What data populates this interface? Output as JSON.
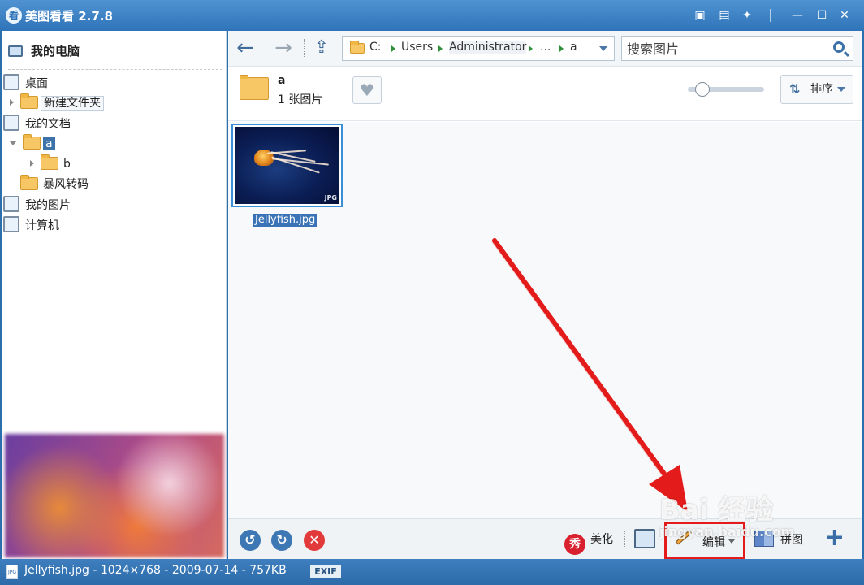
{
  "window": {
    "icon_char": "看",
    "title": "美图看看 2.7.8",
    "buttons": [
      "feedback",
      "menu",
      "skin",
      "minimize",
      "maximize",
      "close"
    ]
  },
  "sidebar": {
    "root_label": "我的电脑",
    "tree": [
      {
        "label": "桌面",
        "icon": "desktop-icon"
      },
      {
        "label": "新建文件夹",
        "icon": "folder-icon"
      },
      {
        "label": "我的文档",
        "icon": "documents-icon"
      },
      {
        "label": "a",
        "icon": "folder-icon",
        "selected": true
      },
      {
        "label": "b",
        "icon": "folder-icon"
      },
      {
        "label": "暴风转码",
        "icon": "folder-icon"
      },
      {
        "label": "我的图片",
        "icon": "pictures-icon"
      },
      {
        "label": "计算机",
        "icon": "computer-icon"
      }
    ]
  },
  "toolbar": {
    "breadcrumb": [
      "C:",
      "Users",
      "Administrator",
      "...",
      "a"
    ],
    "search_placeholder": "搜索图片"
  },
  "folder_info": {
    "name": "a",
    "count": "1 张图片",
    "zoom_level": 0.12
  },
  "sort": {
    "label": "排序"
  },
  "grid": {
    "items": [
      {
        "filename": "Jellyfish.jpg",
        "badge": "JPG",
        "selected": true
      }
    ]
  },
  "bottom": {
    "beautify_icon": "秀",
    "beautify_label": "美化",
    "edit_label": "编辑",
    "collage_label": "拼图",
    "add_label": "+"
  },
  "status": {
    "file_icon": "JPG",
    "text": "Jellyfish.jpg - 1024×768 - 2009-07-14 - 757KB",
    "exif": "EXIF"
  },
  "watermark": {
    "line1": "Bai 经验",
    "line2": "jingyan.baidu.com"
  },
  "colors": {
    "titlebar": "#3a7fc0",
    "selection": "#3b74b6",
    "highlight_box": "#e31b1b",
    "arrow": "#e31b1b"
  }
}
